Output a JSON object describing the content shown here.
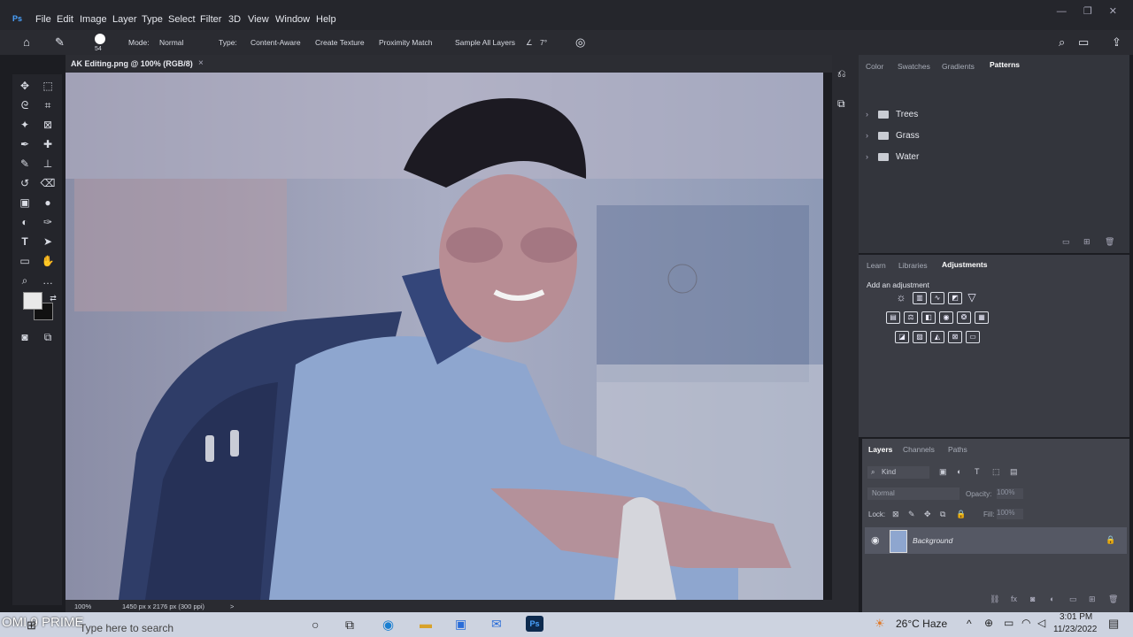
{
  "app": {
    "logo": "Ps"
  },
  "menu": [
    "File",
    "Edit",
    "Image",
    "Layer",
    "Type",
    "Select",
    "Filter",
    "3D",
    "View",
    "Window",
    "Help"
  ],
  "options": {
    "brush_size": "54",
    "mode_label": "Mode:",
    "mode_value": "Normal",
    "type_label": "Type:",
    "type_content_aware": "Content-Aware",
    "type_create_texture": "Create Texture",
    "type_proximity_match": "Proximity Match",
    "sample_all_layers": "Sample All Layers",
    "angle": "7°"
  },
  "document_tab": {
    "title": "AK Editing.png @ 100% (RGB/8)",
    "close": "×"
  },
  "status": {
    "zoom": "100%",
    "dimensions": "1450 px x 2176 px (300 ppi)",
    "arrow": ">"
  },
  "patterns_panel": {
    "tabs": [
      "Color",
      "Swatches",
      "Gradients",
      "Patterns"
    ],
    "active_tab": "Patterns",
    "folders": [
      "Trees",
      "Grass",
      "Water"
    ]
  },
  "adjustments_panel": {
    "tabs": [
      "Learn",
      "Libraries",
      "Adjustments"
    ],
    "active_tab": "Adjustments",
    "hint": "Add an adjustment"
  },
  "layers_panel": {
    "tabs": [
      "Layers",
      "Channels",
      "Paths"
    ],
    "active_tab": "Layers",
    "kind_label": "Kind",
    "blend_mode": "Normal",
    "opacity_label": "Opacity:",
    "opacity_value": "100%",
    "lock_label": "Lock:",
    "fill_label": "Fill:",
    "fill_value": "100%",
    "layer_name": "Background"
  },
  "taskbar": {
    "watermark": "OMI 9 PRIME",
    "search_placeholder": "Type here to search",
    "weather": "26°C  Haze",
    "time": "3:01 PM",
    "date": "11/23/2022"
  },
  "colors": {
    "accent": "#4aa3ff",
    "fg_swatch": "#e9e9e9",
    "bg_swatch": "#111111"
  }
}
